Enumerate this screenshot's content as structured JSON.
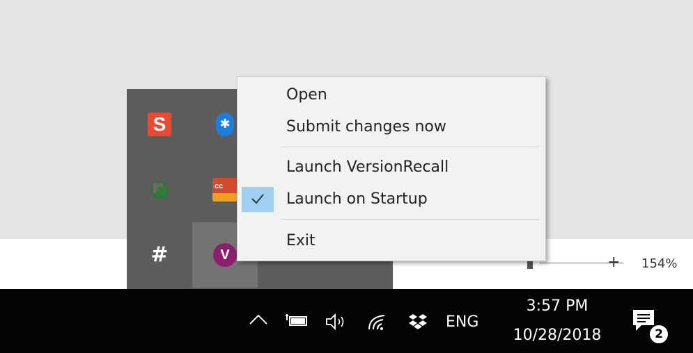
{
  "zoom": {
    "minus_icon": "minus-icon",
    "plus_label": "+",
    "value": "154%",
    "level_percent": 154
  },
  "tray_overflow": {
    "icons": [
      {
        "name": "snagit-icon",
        "glyph": "S",
        "color": "#e94a35"
      },
      {
        "name": "bluetooth-icon",
        "glyph": "✱",
        "color": "#1c7fe0"
      },
      {
        "name": "green-app-icon",
        "color": "#3a7d3a"
      },
      {
        "name": "cc-app-icon",
        "glyph": "cc",
        "color": "#d44a2a"
      },
      {
        "name": "slack-icon",
        "glyph": "#",
        "color": "#ffffff"
      },
      {
        "name": "versionrecall-icon",
        "glyph": "V",
        "color": "#8c1f6d"
      }
    ]
  },
  "context_menu": {
    "items": [
      {
        "label": "Open",
        "checked": false
      },
      {
        "label": "Submit changes now",
        "checked": false
      },
      {
        "label": "Launch VersionRecall",
        "checked": false
      },
      {
        "label": "Launch on Startup",
        "checked": true
      },
      {
        "label": "Exit",
        "checked": false
      }
    ],
    "check_highlight_color": "#9fd0f2"
  },
  "taskbar": {
    "chevron": "^",
    "language": "ENG",
    "time": "3:57 PM",
    "date": "10/28/2018",
    "notification_count": "2",
    "icons": [
      "chevron-up-icon",
      "battery-icon",
      "volume-icon",
      "wifi-icon",
      "dropbox-icon",
      "notifications-icon"
    ]
  }
}
